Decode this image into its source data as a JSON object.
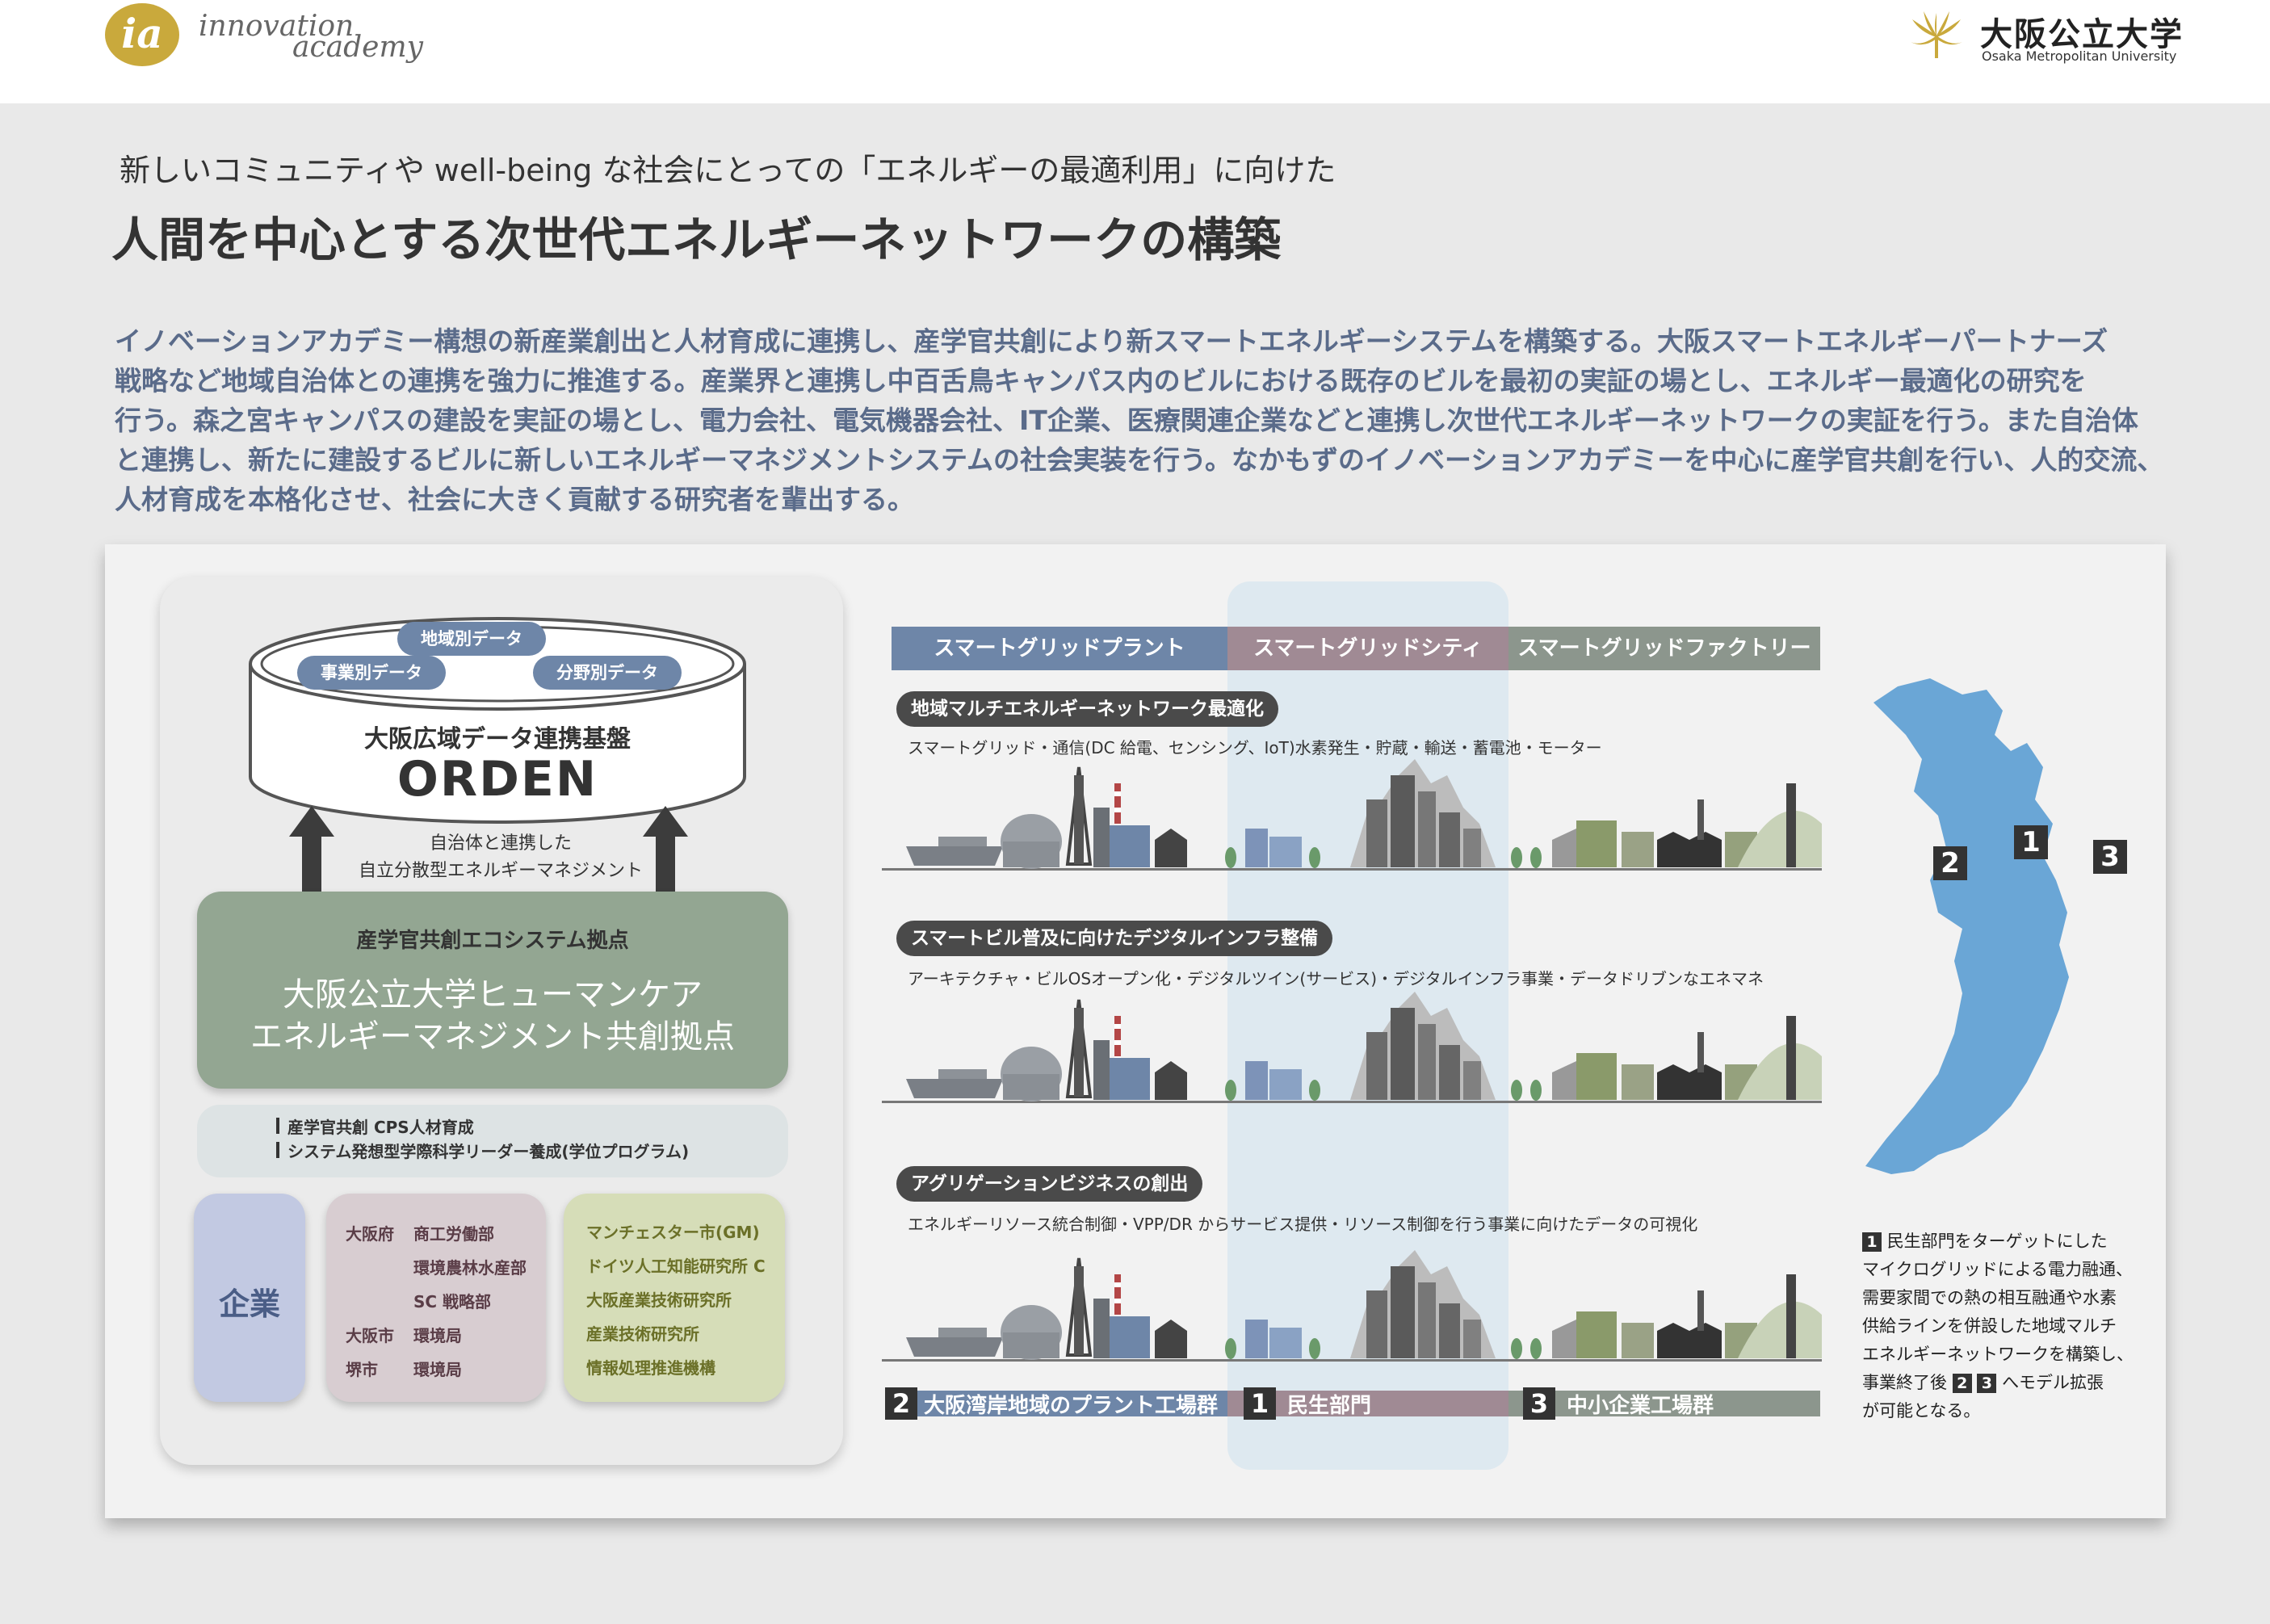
{
  "header": {
    "logo_mark": "ia",
    "logo_word1": "innovation",
    "logo_word2": "academy",
    "university_jp": "大阪公立大学",
    "university_en": "Osaka Metropolitan University"
  },
  "subtitle": "新しいコミュニティや well-being な社会にとっての「エネルギーの最適利用」に向けた",
  "title": "人間を中心とする次世代エネルギーネットワークの構築",
  "description": [
    "イノベーションアカデミー構想の新産業創出と人材育成に連携し、産学官共創により新スマートエネルギーシステムを構築する。大阪スマートエネルギーパートナーズ",
    "戦略など地域自治体との連携を強力に推進する。産業界と連携し中百舌鳥キャンパス内のビルにおける既存のビルを最初の実証の場とし、エネルギー最適化の研究を",
    "行う。森之宮キャンパスの建設を実証の場とし、電力会社、電気機器会社、IT企業、医療関連企業などと連携し次世代エネルギーネットワークの実証を行う。また自治体",
    "と連携し、新たに建設するビルに新しいエネルギーマネジメントシステムの社会実装を行う。なかもずのイノベーションアカデミーを中心に産学官共創を行い、人的交流、",
    "人材育成を本格化させ、社会に大きく貢献する研究者を輩出する。"
  ],
  "platform": {
    "pills": [
      "地域別データ",
      "事業別データ",
      "分野別データ"
    ],
    "name": "大阪広域データ連携基盤",
    "brand": "ORDEN",
    "link_text": [
      "自治体と連携した",
      "自立分散型エネルギーマネジメント"
    ]
  },
  "hub": {
    "sub": "産学官共創エコシステム拠点",
    "main": [
      "大阪公立大学ヒューマンケア",
      "エネルギーマネジメント共創拠点"
    ],
    "programs": [
      "産学官共創 CPS人材育成",
      "システム発想型学際科学リーダー養成(学位プログラム)"
    ]
  },
  "partners": {
    "company": "企業",
    "government": [
      {
        "pref": "大阪府",
        "dept": "商工労働部"
      },
      {
        "pref": "",
        "dept": "環境農林水産部"
      },
      {
        "pref": "",
        "dept": "SC 戦略部"
      },
      {
        "pref": "大阪市",
        "dept": "環境局"
      },
      {
        "pref": "堺市",
        "dept": "環境局"
      }
    ],
    "research": [
      "マンチェスター市(GM)",
      "ドイツ人工知能研究所 C",
      "大阪産業技術研究所",
      "産業技術研究所",
      "情報処理推進機構"
    ]
  },
  "columns": [
    {
      "label": "スマートグリッドプラント",
      "color": "#6e86a8"
    },
    {
      "label": "スマートグリッドシティ",
      "color": "#a08a94"
    },
    {
      "label": "スマートグリッドファクトリー",
      "color": "#8c968d"
    }
  ],
  "sections": [
    {
      "tag": "地域マルチエネルギーネットワーク最適化",
      "desc": "スマートグリッド・通信(DC 給電、センシング、IoT)水素発生・貯蔵・輸送・蓄電池・モーター"
    },
    {
      "tag": "スマートビル普及に向けたデジタルインフラ整備",
      "desc": "アーキテクチャ・ビルOSオープン化・デジタルツイン(サービス)・デジタルインフラ事業・データドリブンなエネマネ"
    },
    {
      "tag": "アグリゲーションビジネスの創出",
      "desc": "エネルギーリソース統合制御・VPP/DR からサービス提供・リソース制御を行う事業に向けたデータの可視化"
    }
  ],
  "bottom": [
    {
      "num": "2",
      "label": "大阪湾岸地域のプラント工場群",
      "color": "#6e86a8"
    },
    {
      "num": "1",
      "label": "民生部門",
      "color": "#a08a94"
    },
    {
      "num": "3",
      "label": "中小企業工場群",
      "color": "#8c968d"
    }
  ],
  "map": {
    "labels": [
      "2",
      "1",
      "3"
    ],
    "color": "#6aa6d6"
  },
  "note": {
    "lines": [
      "民生部門をターゲットにした",
      "マイクログリッドによる電力融通、",
      "需要家間での熱の相互融通や水素",
      "供給ラインを併設した地域マルチ",
      "エネルギーネットワークを構築し、",
      "事業終了後",
      "へモデル拡張",
      "が可能となる。"
    ],
    "num1": "1",
    "num2": "2",
    "num3": "3"
  }
}
